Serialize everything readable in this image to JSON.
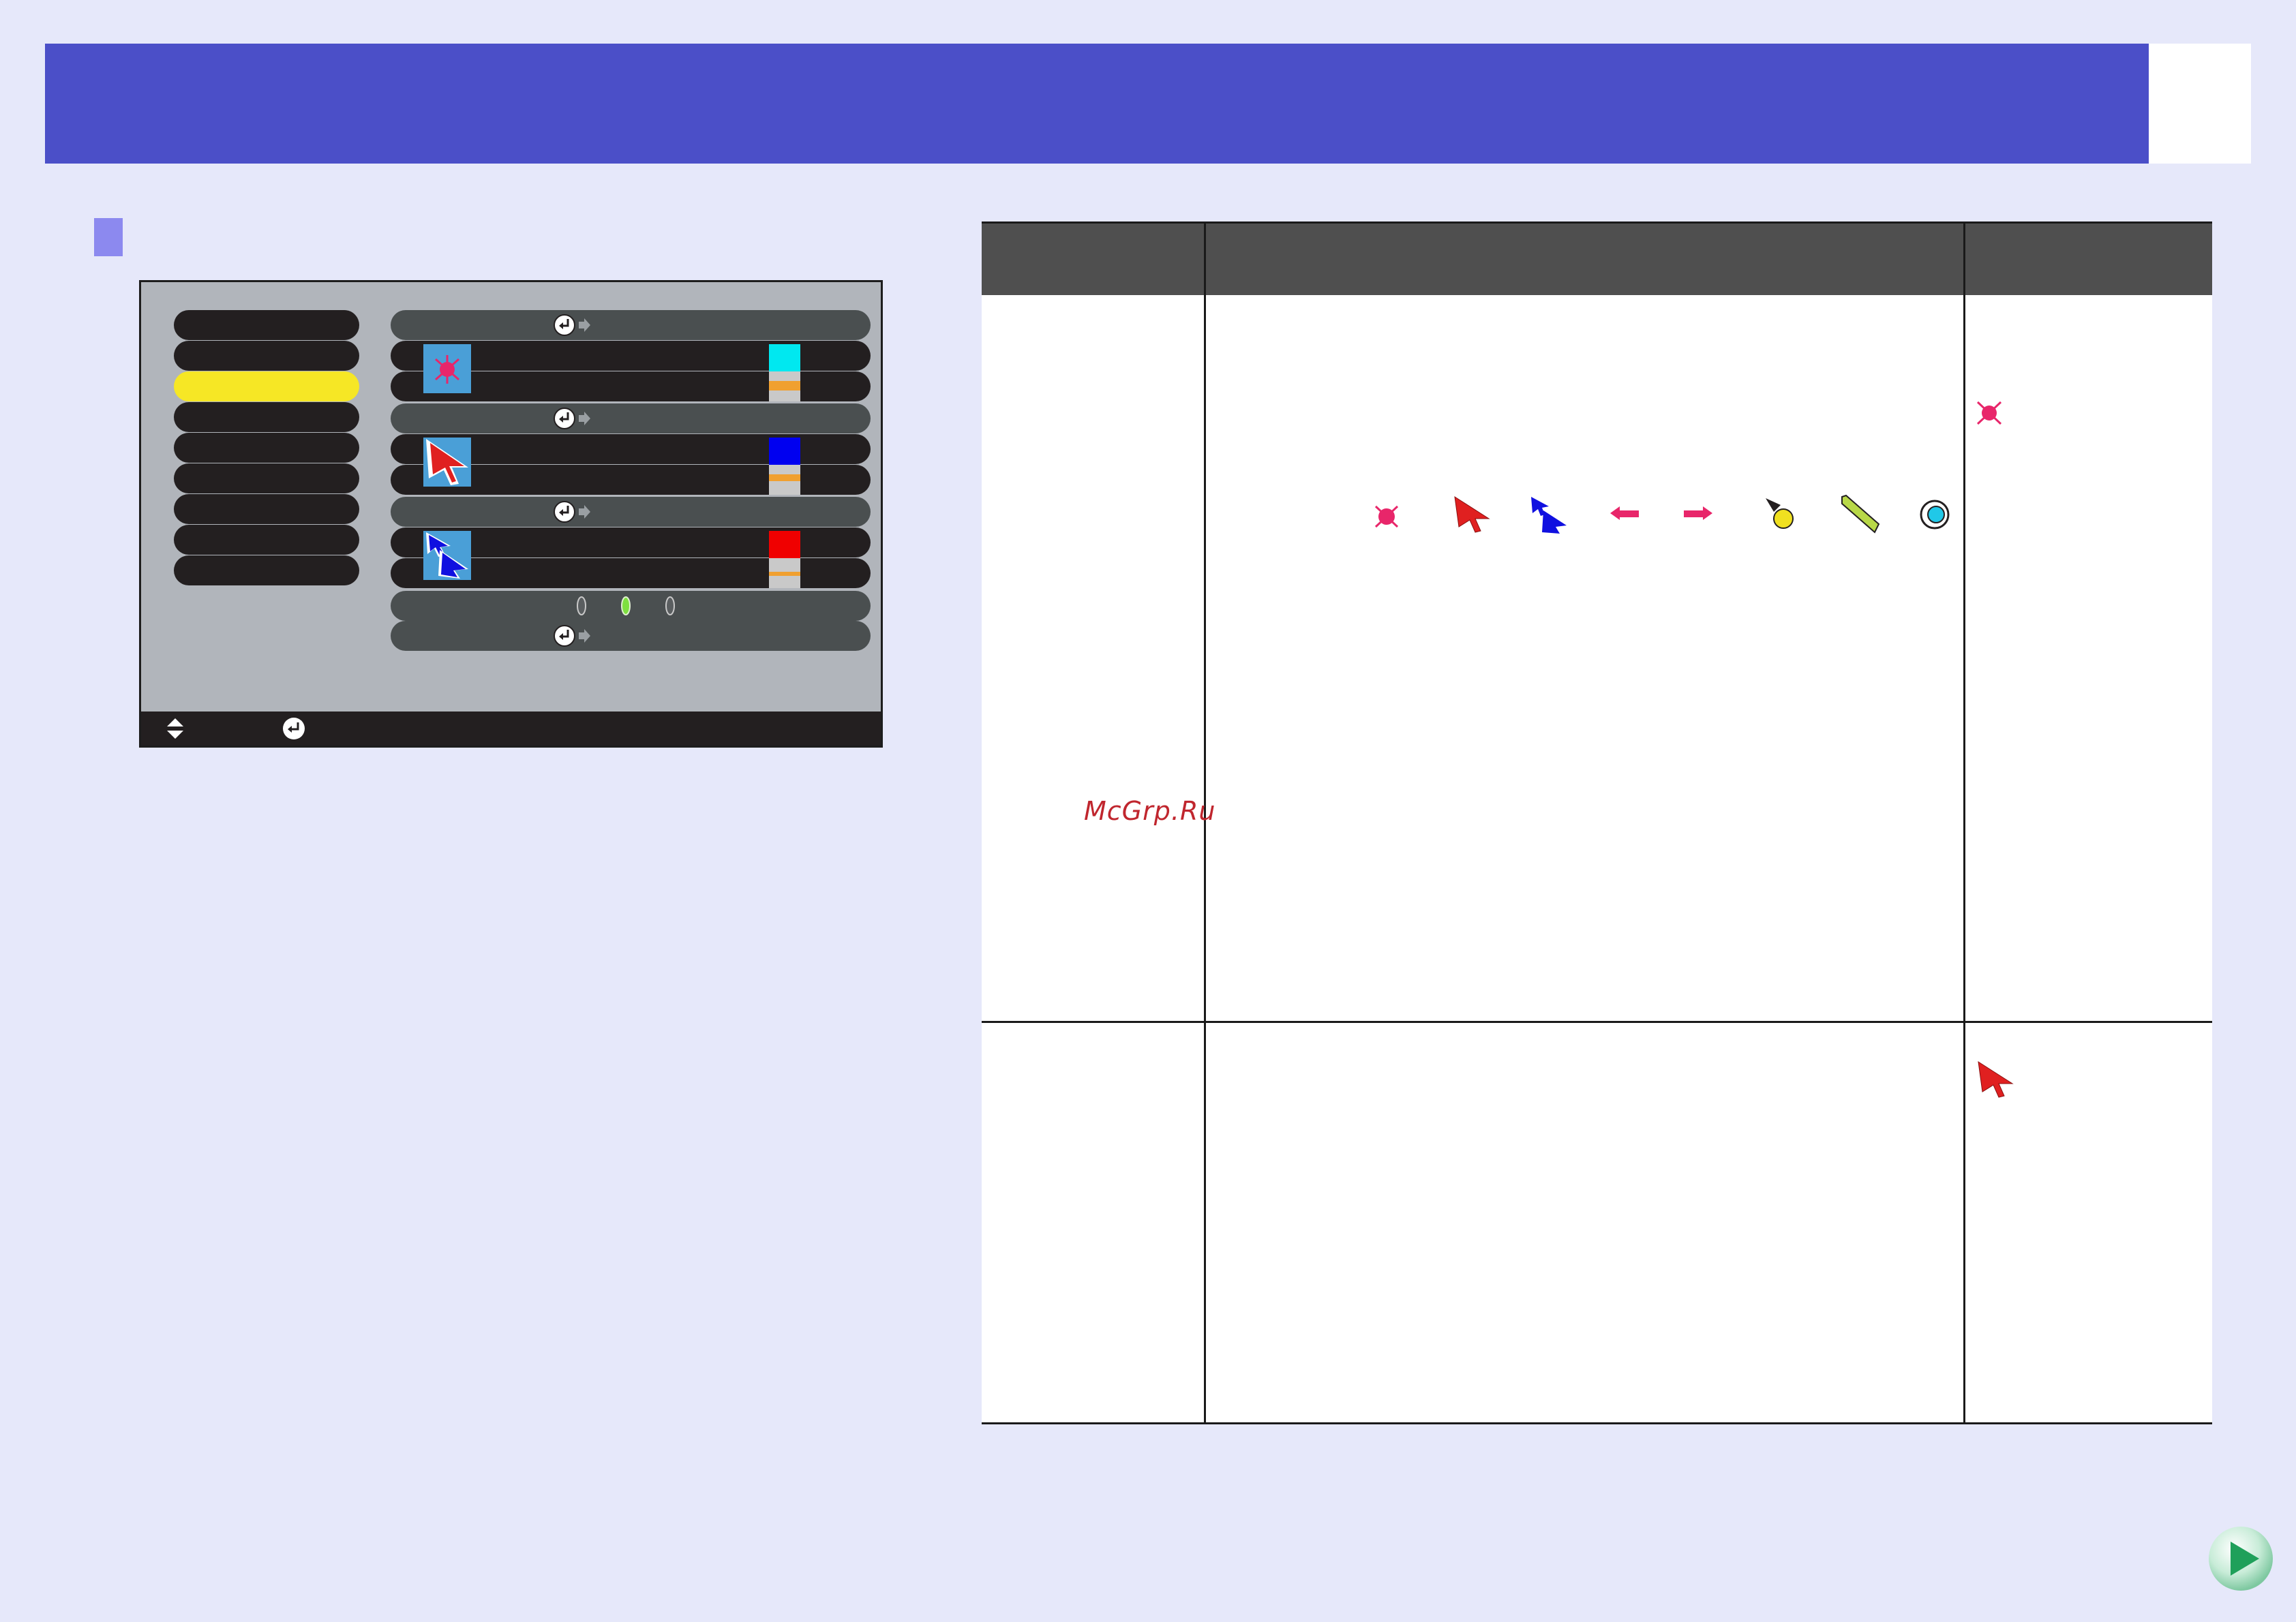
{
  "watermark": "McGrp.Ru",
  "colors": {
    "header": "#4b4fc8",
    "page_background": "#e6e8fa",
    "menu_background": "#b1b5bb",
    "selected_item": "#f6e725",
    "table_header": "#4f4f4f"
  },
  "menu": {
    "left_items_count": 9,
    "selected_index": 2,
    "pointer_rows": [
      {
        "icon": "star-pointer-icon",
        "swatch_colors": [
          "#00e8f0",
          "#c9c9c9",
          "#f0a030",
          "#c9c9c9"
        ]
      },
      {
        "icon": "red-arrow-pointer-icon",
        "swatch_colors": [
          "#0000f0",
          "#c9c9c9",
          "#f0a030",
          "#c9c9c9"
        ]
      },
      {
        "icon": "blue-double-arrow-pointer-icon",
        "swatch_colors": [
          "#f00000",
          "#c9c9c9",
          "#f0a030",
          "#c9c9c9"
        ]
      }
    ],
    "radio_selected_index": 1,
    "bottom_icons": [
      "up-down-arrows-icon",
      "enter-icon"
    ]
  },
  "table": {
    "pointer_icon_row": [
      "star-pointer-icon",
      "red-arrow-pointer-icon",
      "blue-double-arrow-pointer-icon",
      "left-arrow-pointer-icon",
      "right-arrow-pointer-icon",
      "ball-pointer-icon",
      "pencil-pointer-icon",
      "spiral-pointer-icon"
    ],
    "row1_default_icon": "star-pointer-icon",
    "row2_default_icon": "red-arrow-pointer-icon"
  },
  "navigation": {
    "next_icon": "next-page-icon"
  }
}
